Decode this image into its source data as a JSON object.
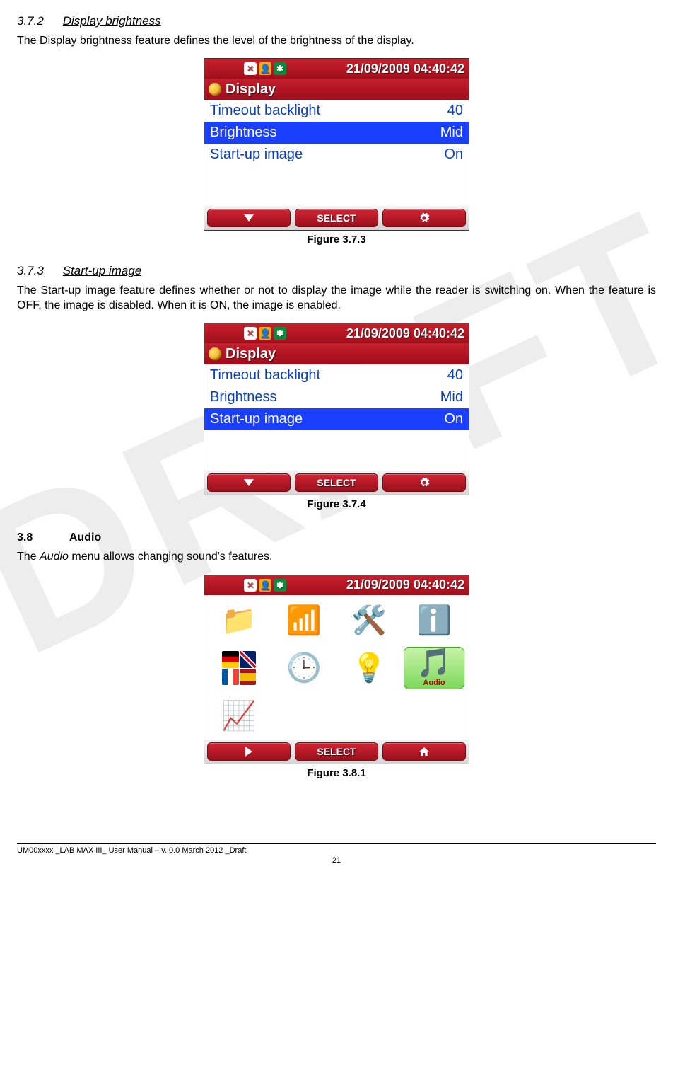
{
  "watermark": "DRAFT",
  "section_3_7_2": {
    "num": "3.7.2",
    "title": "Display brightness",
    "body": "The Display brightness feature defines the level of the brightness of the display."
  },
  "fig_3_7_3": {
    "caption": "Figure 3.7.3",
    "status_date": "21/09/2009 04:40:42",
    "title": "Display",
    "rows": [
      {
        "label": "Timeout backlight",
        "value": "40",
        "selected": false
      },
      {
        "label": "Brightness",
        "value": "Mid",
        "selected": true
      },
      {
        "label": "Start-up image",
        "value": "On",
        "selected": false
      }
    ],
    "btn_mid": "SELECT"
  },
  "section_3_7_3": {
    "num": "3.7.3",
    "title": "Start-up image",
    "body": "The Start-up image feature defines whether or not to display the image while the reader is switching on. When the feature is OFF, the image is disabled. When it is ON, the image is enabled."
  },
  "fig_3_7_4": {
    "caption": "Figure 3.7.4",
    "status_date": "21/09/2009 04:40:42",
    "title": "Display",
    "rows": [
      {
        "label": "Timeout backlight",
        "value": "40",
        "selected": false
      },
      {
        "label": "Brightness",
        "value": "Mid",
        "selected": false
      },
      {
        "label": "Start-up image",
        "value": "On",
        "selected": true
      }
    ],
    "btn_mid": "SELECT"
  },
  "section_3_8": {
    "num": "3.8",
    "title": "Audio",
    "body_prefix": "The ",
    "body_ital": "Audio",
    "body_suffix": " menu allows changing sound's features."
  },
  "fig_3_8_1": {
    "caption": "Figure 3.8.1",
    "status_date": "21/09/2009 04:40:42",
    "btn_mid": "SELECT",
    "selected_label": "Audio"
  },
  "footer": {
    "left": "UM00xxxx _LAB MAX III_ User Manual – v. 0.0 March 2012 _Draft",
    "page": "21"
  }
}
